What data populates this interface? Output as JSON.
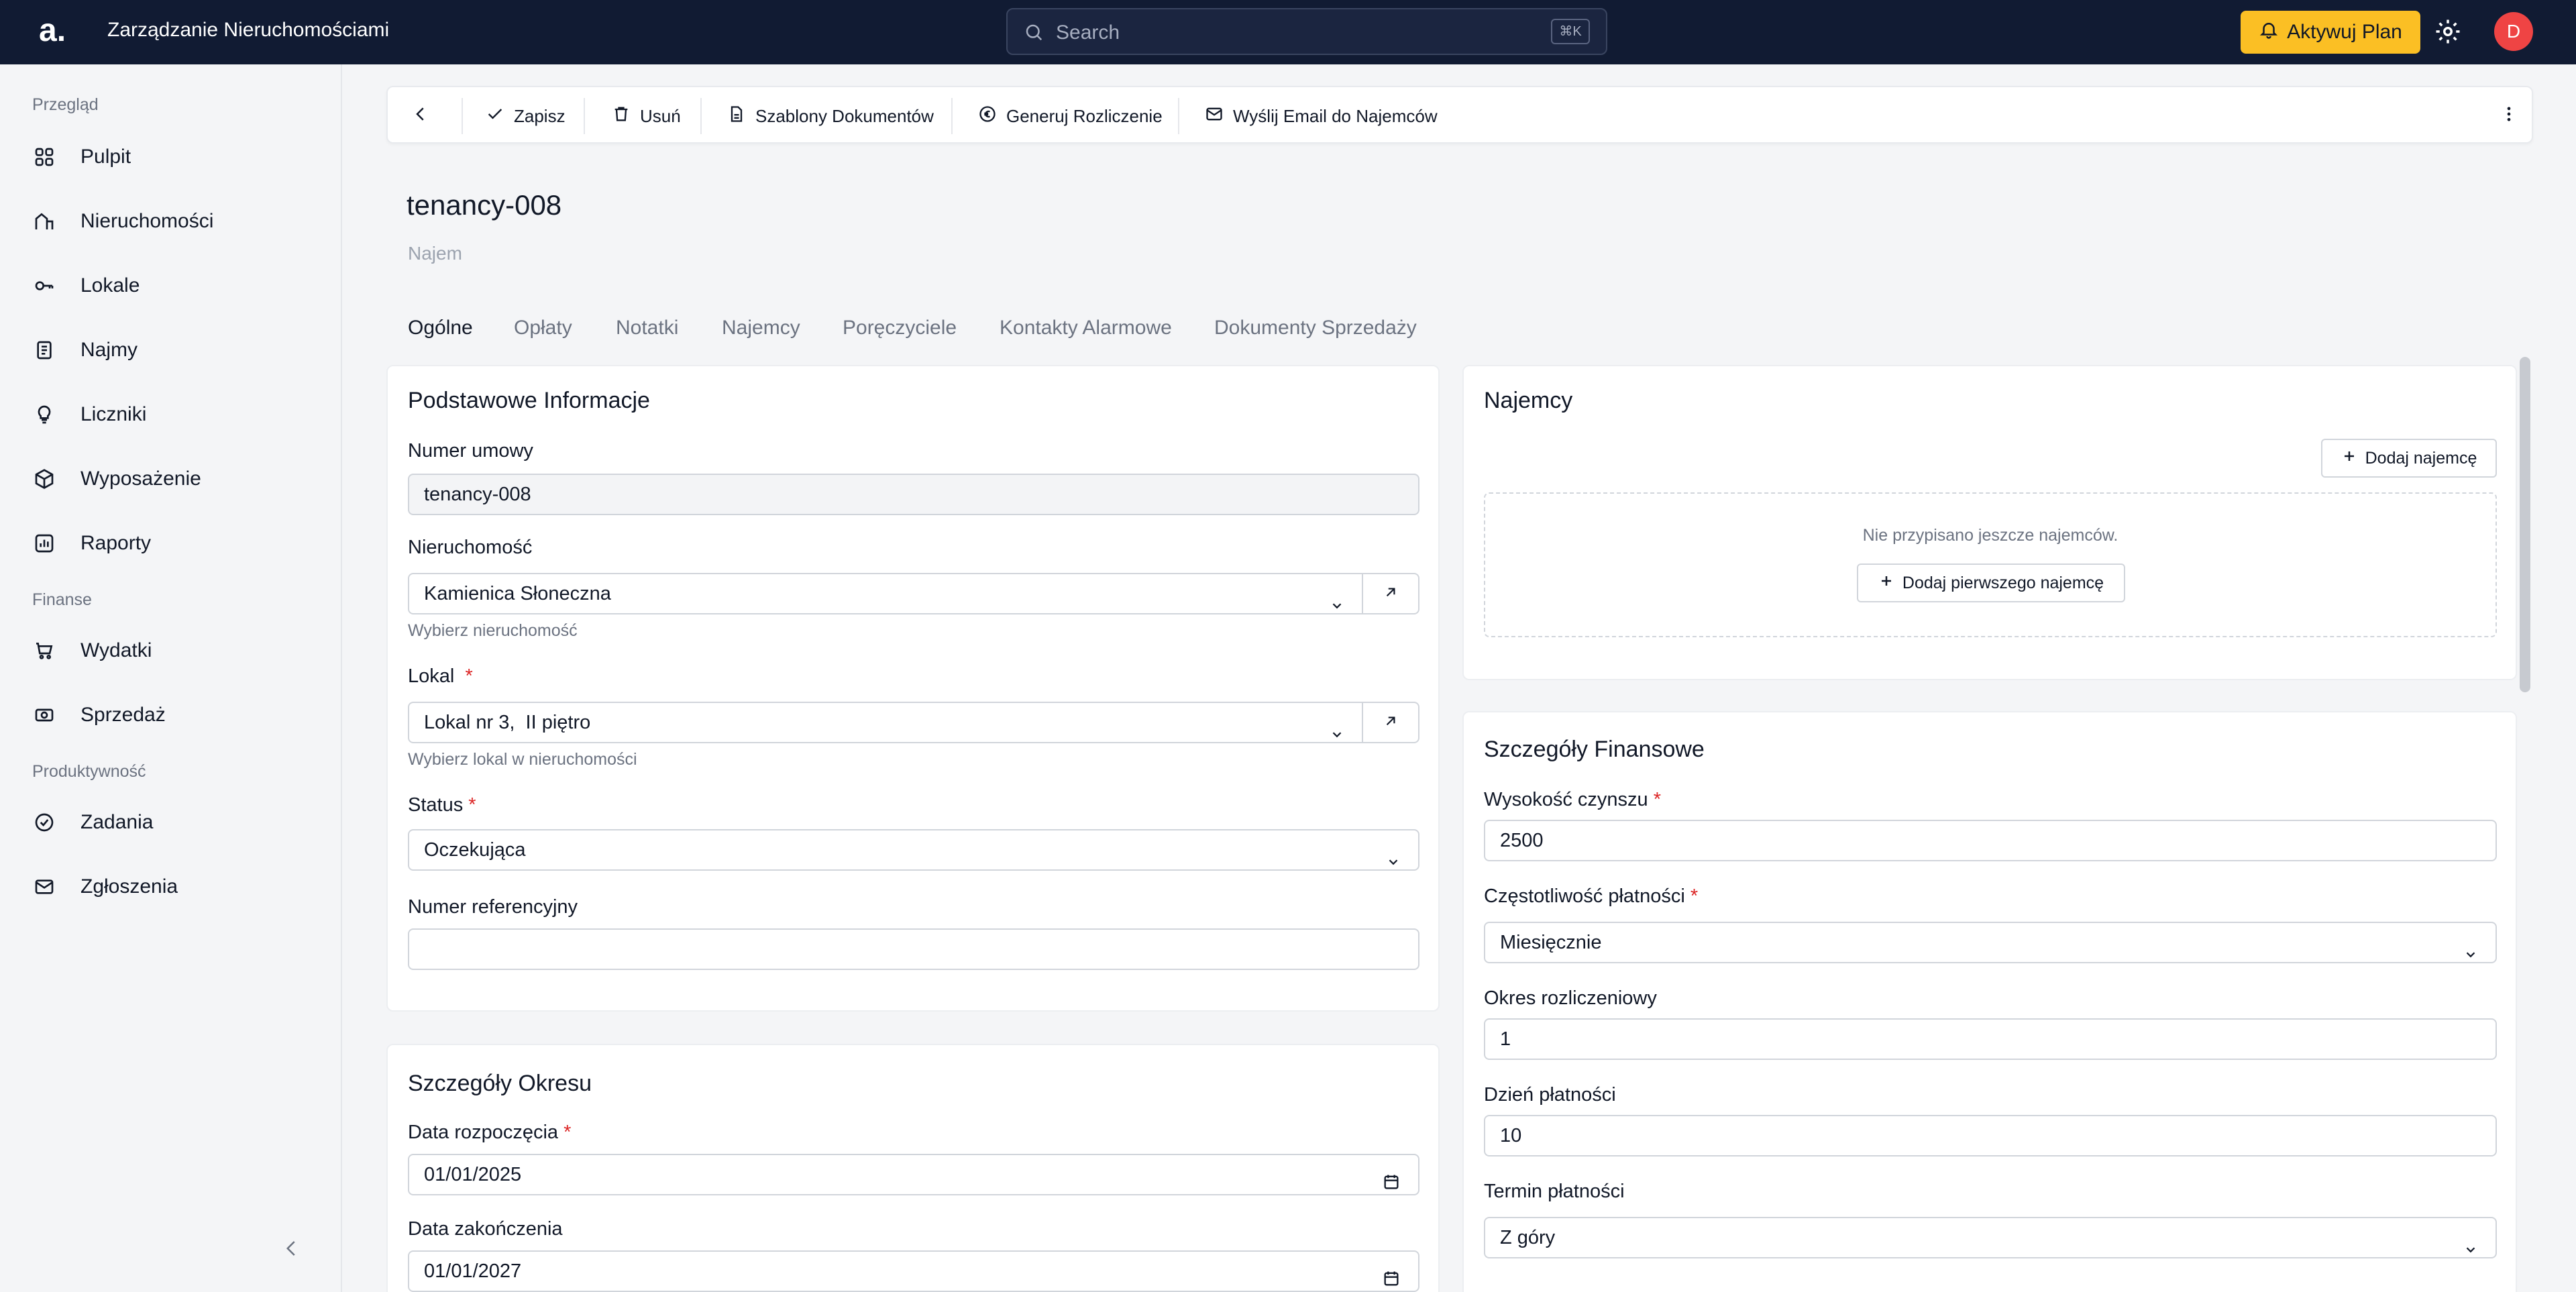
{
  "header": {
    "logo": "a.",
    "app_title": "Zarządzanie Nieruchomościami",
    "search_placeholder": "Search",
    "search_shortcut": "⌘K",
    "upgrade_label": "Aktywuj Plan",
    "avatar_initial": "D"
  },
  "sidebar": {
    "sections": [
      {
        "title": "Przegląd",
        "items": [
          {
            "label": "Pulpit",
            "icon": "grid-icon"
          },
          {
            "label": "Nieruchomości",
            "icon": "building-icon"
          },
          {
            "label": "Lokale",
            "icon": "key-icon"
          },
          {
            "label": "Najmy",
            "icon": "document-icon"
          },
          {
            "label": "Liczniki",
            "icon": "lightbulb-icon"
          },
          {
            "label": "Wyposażenie",
            "icon": "box-icon"
          },
          {
            "label": "Raporty",
            "icon": "report-icon"
          }
        ]
      },
      {
        "title": "Finanse",
        "items": [
          {
            "label": "Wydatki",
            "icon": "cart-icon"
          },
          {
            "label": "Sprzedaż",
            "icon": "money-icon"
          }
        ]
      },
      {
        "title": "Produktywność",
        "items": [
          {
            "label": "Zadania",
            "icon": "check-circle-icon"
          },
          {
            "label": "Zgłoszenia",
            "icon": "mail-icon"
          }
        ]
      }
    ]
  },
  "toolbar": {
    "save": "Zapisz",
    "delete": "Usuń",
    "templates": "Szablony Dokumentów",
    "settlement": "Generuj Rozliczenie",
    "email": "Wyślij Email do Najemców"
  },
  "page": {
    "title": "tenancy-008",
    "subtitle": "Najem"
  },
  "tabs": [
    "Ogólne",
    "Opłaty",
    "Notatki",
    "Najemcy",
    "Poręczyciele",
    "Kontakty Alarmowe",
    "Dokumenty Sprzedaży"
  ],
  "basic_info": {
    "title": "Podstawowe Informacje",
    "contract_label": "Numer umowy",
    "contract_value": "tenancy-008",
    "property_label": "Nieruchomość",
    "property_value": "Kamienica Słoneczna",
    "property_hint": "Wybierz nieruchomość",
    "unit_label": "Lokal",
    "unit_value": "Lokal nr 3,  II piętro",
    "unit_hint": "Wybierz lokal w nieruchomości",
    "status_label": "Status",
    "status_value": "Oczekująca",
    "ref_label": "Numer referencyjny",
    "ref_value": ""
  },
  "period": {
    "title": "Szczegóły Okresu",
    "start_label": "Data rozpoczęcia",
    "start_value": "01/01/2025",
    "end_label": "Data zakończenia",
    "end_value": "01/01/2027"
  },
  "tenants": {
    "title": "Najemcy",
    "add_label": "Dodaj najemcę",
    "empty_text": "Nie przypisano jeszcze najemców.",
    "add_first_label": "Dodaj pierwszego najemcę"
  },
  "finance": {
    "title": "Szczegóły Finansowe",
    "rent_label": "Wysokość czynszu",
    "rent_value": "2500",
    "freq_label": "Częstotliwość płatności",
    "freq_value": "Miesięcznie",
    "period_label": "Okres rozliczeniowy",
    "period_value": "1",
    "day_label": "Dzień płatności",
    "day_value": "10",
    "term_label": "Termin płatności",
    "term_value": "Z góry"
  },
  "colors": {
    "header_bg": "#111b33",
    "accent": "#fbbf24",
    "avatar": "#ef4444",
    "required": "#dc2626"
  }
}
